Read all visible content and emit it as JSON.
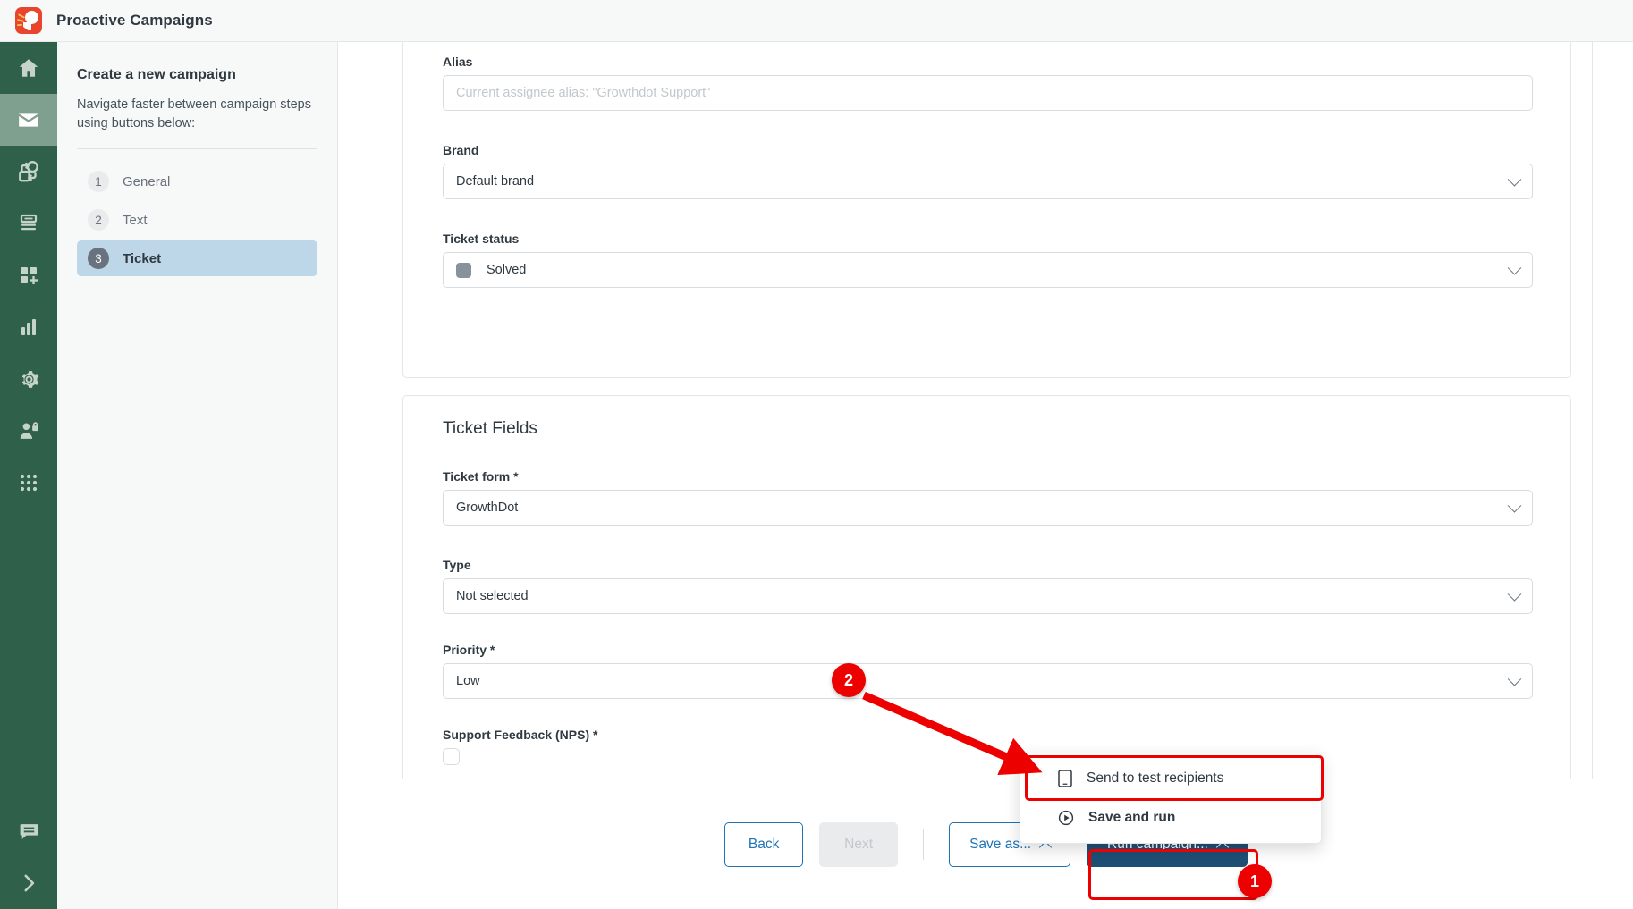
{
  "header": {
    "title": "Proactive Campaigns",
    "logo_icon": "proactive-campaigns-logo"
  },
  "rail": {
    "items": [
      {
        "icon": "home-icon",
        "active": false
      },
      {
        "icon": "mail-icon",
        "active": true
      },
      {
        "icon": "automation-loop-icon",
        "active": false
      },
      {
        "icon": "database-icon",
        "active": false
      },
      {
        "icon": "add-module-icon",
        "active": false
      },
      {
        "icon": "bar-chart-icon",
        "active": false
      },
      {
        "icon": "gear-icon",
        "active": false
      },
      {
        "icon": "user-lock-icon",
        "active": false
      },
      {
        "icon": "apps-grid-icon",
        "active": false
      }
    ],
    "bottom_items": [
      {
        "icon": "chat-bubble-icon"
      },
      {
        "icon": "chevron-right-icon"
      }
    ]
  },
  "navpanel": {
    "title": "Create a new campaign",
    "subtitle": "Navigate faster between campaign steps using buttons below:",
    "steps": [
      {
        "num": "1",
        "label": "General",
        "active": false
      },
      {
        "num": "2",
        "label": "Text",
        "active": false
      },
      {
        "num": "3",
        "label": "Ticket",
        "active": true
      }
    ]
  },
  "form": {
    "assignee_card": {
      "alias": {
        "label": "Alias",
        "placeholder": "Current assignee alias: \"Growthdot Support\"",
        "value": ""
      },
      "brand": {
        "label": "Brand",
        "value": "Default brand"
      },
      "ticket_status": {
        "label": "Ticket status",
        "value": "Solved",
        "swatch_color": "#87929d"
      }
    },
    "ticket_fields_card": {
      "title": "Ticket Fields",
      "ticket_form": {
        "label": "Ticket form *",
        "value": "GrowthDot"
      },
      "type": {
        "label": "Type",
        "value": "Not selected"
      },
      "priority": {
        "label": "Priority *",
        "value": "Low"
      },
      "nps": {
        "label": "Support Feedback (NPS) *",
        "checked": false
      }
    }
  },
  "footer": {
    "back_label": "Back",
    "next_label": "Next",
    "save_as_label": "Save as...",
    "run_campaign_label": "Run campaign..."
  },
  "menu": {
    "items": [
      {
        "label": "Send to test recipients",
        "icon": "mobile-device-icon",
        "bold": false
      },
      {
        "label": "Save and run",
        "icon": "play-circle-icon",
        "bold": true
      }
    ]
  },
  "annotations": {
    "badges": [
      {
        "id": "1",
        "label": "1"
      },
      {
        "id": "2",
        "label": "2"
      }
    ],
    "accent_color": "#ed0000"
  },
  "colors": {
    "rail_green": "#2f6049",
    "rail_active_green": "#7fa08f",
    "primary_blue": "#1f4f75",
    "link_blue": "#1f73b7",
    "step_active_blue": "#bdd6e8",
    "brand_red": "#e8452c"
  }
}
